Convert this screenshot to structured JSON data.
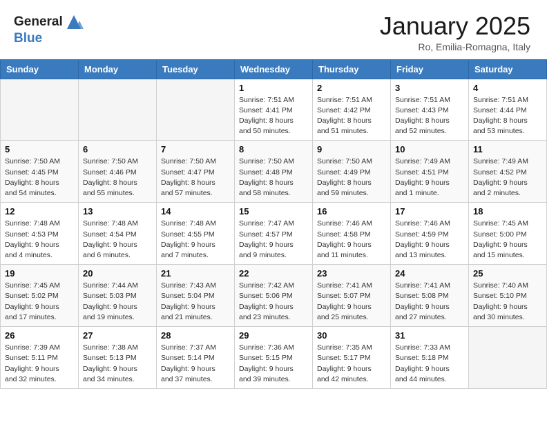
{
  "logo": {
    "line1": "General",
    "line2": "Blue"
  },
  "header": {
    "month": "January 2025",
    "location": "Ro, Emilia-Romagna, Italy"
  },
  "weekdays": [
    "Sunday",
    "Monday",
    "Tuesday",
    "Wednesday",
    "Thursday",
    "Friday",
    "Saturday"
  ],
  "weeks": [
    [
      {
        "day": "",
        "info": ""
      },
      {
        "day": "",
        "info": ""
      },
      {
        "day": "",
        "info": ""
      },
      {
        "day": "1",
        "info": "Sunrise: 7:51 AM\nSunset: 4:41 PM\nDaylight: 8 hours\nand 50 minutes."
      },
      {
        "day": "2",
        "info": "Sunrise: 7:51 AM\nSunset: 4:42 PM\nDaylight: 8 hours\nand 51 minutes."
      },
      {
        "day": "3",
        "info": "Sunrise: 7:51 AM\nSunset: 4:43 PM\nDaylight: 8 hours\nand 52 minutes."
      },
      {
        "day": "4",
        "info": "Sunrise: 7:51 AM\nSunset: 4:44 PM\nDaylight: 8 hours\nand 53 minutes."
      }
    ],
    [
      {
        "day": "5",
        "info": "Sunrise: 7:50 AM\nSunset: 4:45 PM\nDaylight: 8 hours\nand 54 minutes."
      },
      {
        "day": "6",
        "info": "Sunrise: 7:50 AM\nSunset: 4:46 PM\nDaylight: 8 hours\nand 55 minutes."
      },
      {
        "day": "7",
        "info": "Sunrise: 7:50 AM\nSunset: 4:47 PM\nDaylight: 8 hours\nand 57 minutes."
      },
      {
        "day": "8",
        "info": "Sunrise: 7:50 AM\nSunset: 4:48 PM\nDaylight: 8 hours\nand 58 minutes."
      },
      {
        "day": "9",
        "info": "Sunrise: 7:50 AM\nSunset: 4:49 PM\nDaylight: 8 hours\nand 59 minutes."
      },
      {
        "day": "10",
        "info": "Sunrise: 7:49 AM\nSunset: 4:51 PM\nDaylight: 9 hours\nand 1 minute."
      },
      {
        "day": "11",
        "info": "Sunrise: 7:49 AM\nSunset: 4:52 PM\nDaylight: 9 hours\nand 2 minutes."
      }
    ],
    [
      {
        "day": "12",
        "info": "Sunrise: 7:48 AM\nSunset: 4:53 PM\nDaylight: 9 hours\nand 4 minutes."
      },
      {
        "day": "13",
        "info": "Sunrise: 7:48 AM\nSunset: 4:54 PM\nDaylight: 9 hours\nand 6 minutes."
      },
      {
        "day": "14",
        "info": "Sunrise: 7:48 AM\nSunset: 4:55 PM\nDaylight: 9 hours\nand 7 minutes."
      },
      {
        "day": "15",
        "info": "Sunrise: 7:47 AM\nSunset: 4:57 PM\nDaylight: 9 hours\nand 9 minutes."
      },
      {
        "day": "16",
        "info": "Sunrise: 7:46 AM\nSunset: 4:58 PM\nDaylight: 9 hours\nand 11 minutes."
      },
      {
        "day": "17",
        "info": "Sunrise: 7:46 AM\nSunset: 4:59 PM\nDaylight: 9 hours\nand 13 minutes."
      },
      {
        "day": "18",
        "info": "Sunrise: 7:45 AM\nSunset: 5:00 PM\nDaylight: 9 hours\nand 15 minutes."
      }
    ],
    [
      {
        "day": "19",
        "info": "Sunrise: 7:45 AM\nSunset: 5:02 PM\nDaylight: 9 hours\nand 17 minutes."
      },
      {
        "day": "20",
        "info": "Sunrise: 7:44 AM\nSunset: 5:03 PM\nDaylight: 9 hours\nand 19 minutes."
      },
      {
        "day": "21",
        "info": "Sunrise: 7:43 AM\nSunset: 5:04 PM\nDaylight: 9 hours\nand 21 minutes."
      },
      {
        "day": "22",
        "info": "Sunrise: 7:42 AM\nSunset: 5:06 PM\nDaylight: 9 hours\nand 23 minutes."
      },
      {
        "day": "23",
        "info": "Sunrise: 7:41 AM\nSunset: 5:07 PM\nDaylight: 9 hours\nand 25 minutes."
      },
      {
        "day": "24",
        "info": "Sunrise: 7:41 AM\nSunset: 5:08 PM\nDaylight: 9 hours\nand 27 minutes."
      },
      {
        "day": "25",
        "info": "Sunrise: 7:40 AM\nSunset: 5:10 PM\nDaylight: 9 hours\nand 30 minutes."
      }
    ],
    [
      {
        "day": "26",
        "info": "Sunrise: 7:39 AM\nSunset: 5:11 PM\nDaylight: 9 hours\nand 32 minutes."
      },
      {
        "day": "27",
        "info": "Sunrise: 7:38 AM\nSunset: 5:13 PM\nDaylight: 9 hours\nand 34 minutes."
      },
      {
        "day": "28",
        "info": "Sunrise: 7:37 AM\nSunset: 5:14 PM\nDaylight: 9 hours\nand 37 minutes."
      },
      {
        "day": "29",
        "info": "Sunrise: 7:36 AM\nSunset: 5:15 PM\nDaylight: 9 hours\nand 39 minutes."
      },
      {
        "day": "30",
        "info": "Sunrise: 7:35 AM\nSunset: 5:17 PM\nDaylight: 9 hours\nand 42 minutes."
      },
      {
        "day": "31",
        "info": "Sunrise: 7:33 AM\nSunset: 5:18 PM\nDaylight: 9 hours\nand 44 minutes."
      },
      {
        "day": "",
        "info": ""
      }
    ]
  ]
}
